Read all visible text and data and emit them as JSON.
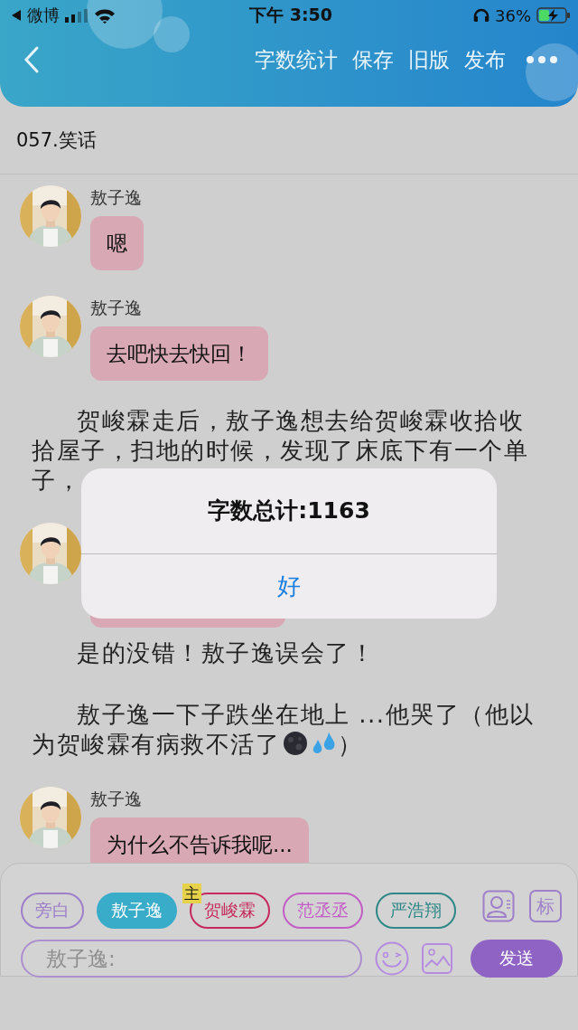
{
  "status_bar": {
    "back_app": "微博",
    "time": "下午 3:50",
    "battery": "36%"
  },
  "nav": {
    "actions": [
      "字数统计",
      "保存",
      "旧版",
      "发布"
    ]
  },
  "title": "057.笑话",
  "content": [
    {
      "kind": "message",
      "name": "敖子逸",
      "text": "嗯"
    },
    {
      "kind": "message",
      "name": "敖子逸",
      "text": "去吧快去快回！"
    },
    {
      "kind": "narration",
      "text": "贺峻霖走后，敖子逸想去给贺峻霖收拾收拾屋子，扫地的时候，发现了床底下有一个单子，"
    },
    {
      "kind": "message"
    },
    {
      "kind": "narration",
      "text": "是的没错！敖子逸误会了！"
    },
    {
      "kind": "narration",
      "text": "敖子逸一下子跌坐在地上 ...他哭了（他以为贺峻霖有病救不活了",
      "after": "）"
    },
    {
      "kind": "message",
      "name": "敖子逸",
      "text": "为什么不告诉我呢..."
    }
  ],
  "roles": [
    {
      "name": "旁白",
      "color": "#9e7fc9",
      "selected": false
    },
    {
      "name": "敖子逸",
      "color": "#39acca",
      "selected": true
    },
    {
      "name": "贺峻霖",
      "color": "#c62a5c",
      "selected": false,
      "badge": "主"
    },
    {
      "name": "范丞丞",
      "color": "#c25ec6",
      "selected": false
    },
    {
      "name": "严浩翔",
      "color": "#2f8787",
      "selected": false
    }
  ],
  "composer": {
    "tag_button": "标",
    "placeholder": "敖子逸:",
    "send": "发送"
  },
  "dialog": {
    "message": "字数总计:1163",
    "button": "好"
  }
}
